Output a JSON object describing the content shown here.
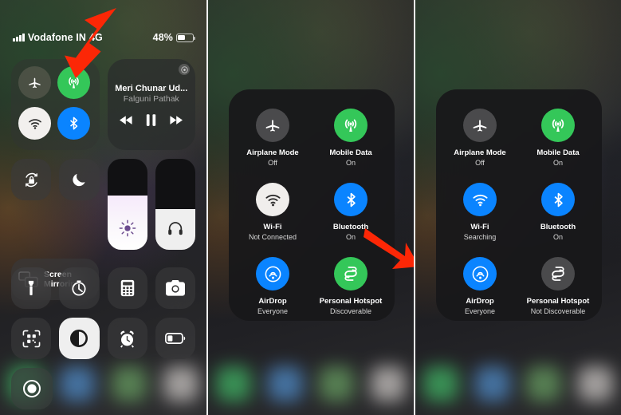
{
  "status_bar": {
    "carrier": "Vodafone IN",
    "network": "4G",
    "signal_icon": "signal-bars-icon",
    "battery_percent": "48%",
    "battery_level": 48,
    "battery_icon": "battery-icon"
  },
  "media_widget": {
    "title": "Meri Chunar Ud...",
    "artist": "Falguni Pathak",
    "airplay_icon": "airplay-icon",
    "prev_icon": "rewind-icon",
    "pause_icon": "pause-icon",
    "next_icon": "fast-forward-icon"
  },
  "control_center": {
    "connectivity": [
      {
        "name": "airplane-mode",
        "icon": "airplane-icon",
        "state": "off",
        "color": "#6e6c60"
      },
      {
        "name": "mobile-data",
        "icon": "antenna-icon",
        "state": "on",
        "color": "#34c759"
      },
      {
        "name": "wifi",
        "icon": "wifi-icon",
        "state": "on",
        "color": "#f2f0ee"
      },
      {
        "name": "bluetooth",
        "icon": "bluetooth-icon",
        "state": "on",
        "color": "#0a84ff"
      }
    ],
    "rotation_lock_label": "Rotation Lock",
    "do_not_disturb_label": "Do Not Disturb",
    "screen_mirroring_label_line1": "Screen",
    "screen_mirroring_label_line2": "Mirroring",
    "brightness_label": "Brightness",
    "brightness_value": 60,
    "volume_label": "Volume",
    "volume_value": 45,
    "shortcuts": [
      {
        "name": "flashlight",
        "icon": "flashlight-icon",
        "active": false
      },
      {
        "name": "timer",
        "icon": "timer-icon",
        "active": false
      },
      {
        "name": "calculator",
        "icon": "calculator-icon",
        "active": false
      },
      {
        "name": "camera",
        "icon": "camera-icon",
        "active": false
      },
      {
        "name": "qr-code-scanner",
        "icon": "qr-code-icon",
        "active": false
      },
      {
        "name": "dark-mode",
        "icon": "contrast-icon",
        "active": true
      },
      {
        "name": "alarm",
        "icon": "alarm-clock-icon",
        "active": false
      },
      {
        "name": "low-power-mode",
        "icon": "battery-low-icon",
        "active": false
      },
      {
        "name": "screen-recording",
        "icon": "record-icon",
        "active": false
      }
    ]
  },
  "middle_panel": {
    "tiles": [
      {
        "name": "airplane-mode",
        "icon": "airplane-icon",
        "label": "Airplane Mode",
        "status": "Off",
        "color": "#4a4a4c",
        "active": false
      },
      {
        "name": "mobile-data",
        "icon": "antenna-icon",
        "label": "Mobile Data",
        "status": "On",
        "color": "#34c759",
        "active": true
      },
      {
        "name": "wifi",
        "icon": "wifi-icon",
        "label": "Wi-Fi",
        "status": "Not Connected",
        "color": "#f0eeec",
        "active": false
      },
      {
        "name": "bluetooth",
        "icon": "bluetooth-icon",
        "label": "Bluetooth",
        "status": "On",
        "color": "#0a84ff",
        "active": true
      },
      {
        "name": "airdrop",
        "icon": "airdrop-icon",
        "label": "AirDrop",
        "status": "Everyone",
        "color": "#0a84ff",
        "active": true
      },
      {
        "name": "personal-hotspot",
        "icon": "hotspot-icon",
        "label": "Personal Hotspot",
        "status": "Discoverable",
        "color": "#34c759",
        "active": true
      }
    ]
  },
  "right_panel": {
    "tiles": [
      {
        "name": "airplane-mode",
        "icon": "airplane-icon",
        "label": "Airplane Mode",
        "status": "Off",
        "color": "#4a4a4c",
        "active": false
      },
      {
        "name": "mobile-data",
        "icon": "antenna-icon",
        "label": "Mobile Data",
        "status": "On",
        "color": "#34c759",
        "active": true
      },
      {
        "name": "wifi",
        "icon": "wifi-icon",
        "label": "Wi-Fi",
        "status": "Searching",
        "color": "#0a84ff",
        "active": true
      },
      {
        "name": "bluetooth",
        "icon": "bluetooth-icon",
        "label": "Bluetooth",
        "status": "On",
        "color": "#0a84ff",
        "active": true
      },
      {
        "name": "airdrop",
        "icon": "airdrop-icon",
        "label": "AirDrop",
        "status": "Everyone",
        "color": "#0a84ff",
        "active": true
      },
      {
        "name": "personal-hotspot",
        "icon": "hotspot-icon",
        "label": "Personal Hotspot",
        "status": "Not Discoverable",
        "color": "#4a4a4c",
        "active": false
      }
    ]
  },
  "annotations": {
    "arrow_color": "#fc2706",
    "arrows": [
      {
        "name": "arrow-to-mobile-data",
        "panel": "left"
      },
      {
        "name": "arrow-to-personal-hotspot",
        "panel": "middle"
      },
      {
        "name": "arrow-to-personal-hotspot",
        "panel": "right"
      }
    ]
  }
}
